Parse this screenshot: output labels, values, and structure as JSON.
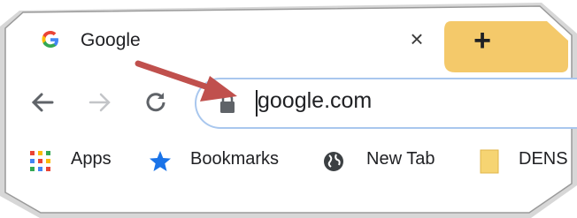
{
  "tab": {
    "title": "Google",
    "favicon": "google-g-icon",
    "close_glyph": "×"
  },
  "new_tab": {
    "glyph": "+",
    "color": "#f4c96a"
  },
  "toolbar": {
    "back_icon": "arrow-left-icon",
    "forward_icon": "arrow-right-icon",
    "reload_icon": "reload-icon"
  },
  "omnibox": {
    "url": "google.com",
    "security_icon": "lock-icon",
    "border_color": "#a9c7ee"
  },
  "bookmarks": {
    "items": [
      {
        "label": "Apps",
        "icon": "apps-grid-icon"
      },
      {
        "label": "Bookmarks",
        "icon": "star-icon"
      },
      {
        "label": "New Tab",
        "icon": "globe-icon"
      },
      {
        "label": "DENS",
        "icon": "folder-icon"
      }
    ]
  },
  "annotation": {
    "arrow_color": "#c0504d"
  }
}
